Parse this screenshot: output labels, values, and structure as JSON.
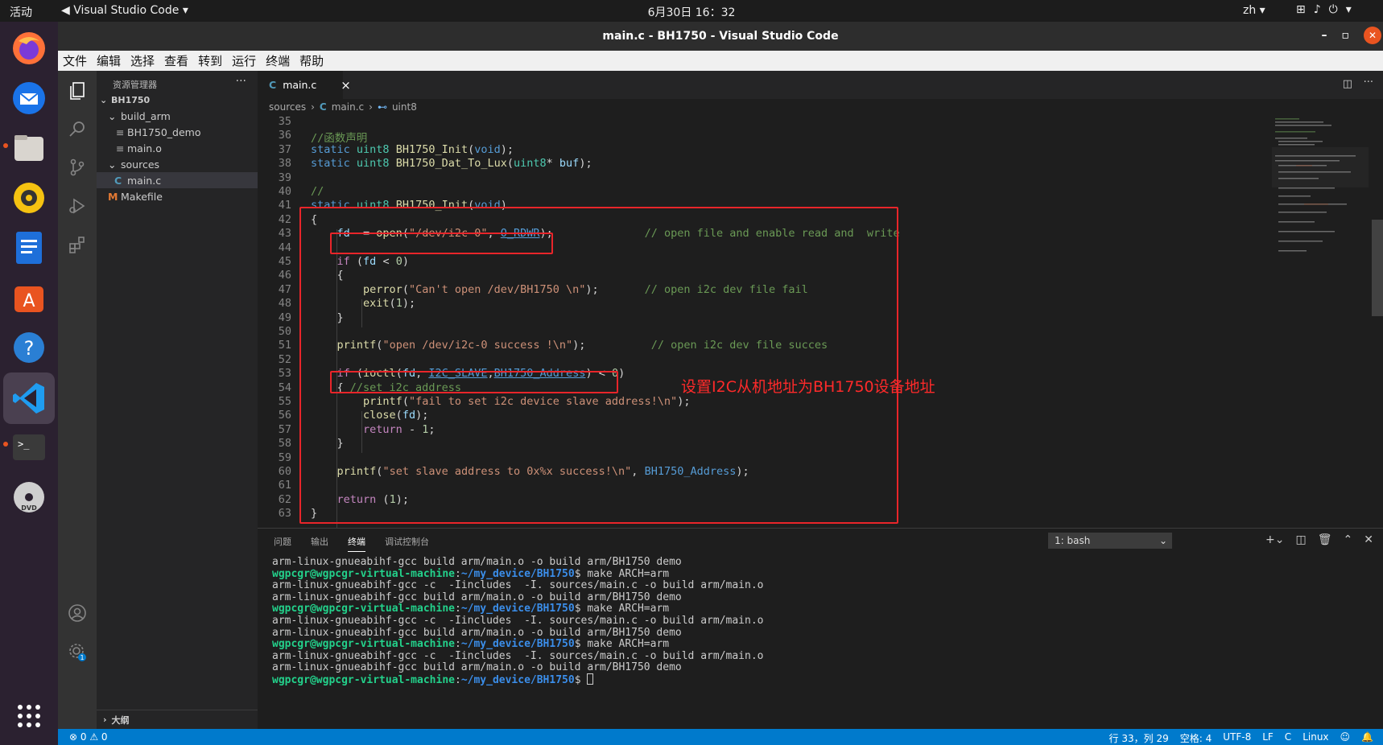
{
  "os": {
    "activities": "活动",
    "app_name": "Visual Studio Code",
    "clock": "6月30日  16：32",
    "input_lang": "zh"
  },
  "window": {
    "title": "main.c - BH1750 - Visual Studio Code"
  },
  "menu": [
    "文件",
    "编辑",
    "选择",
    "查看",
    "转到",
    "运行",
    "终端",
    "帮助"
  ],
  "explorer": {
    "header": "资源管理器",
    "more": "···",
    "project": "BH1750",
    "items": [
      {
        "label": "build_arm",
        "kind": "folder"
      },
      {
        "label": "BH1750_demo",
        "kind": "file"
      },
      {
        "label": "main.o",
        "kind": "file"
      },
      {
        "label": "sources",
        "kind": "folder"
      },
      {
        "label": "main.c",
        "kind": "c"
      },
      {
        "label": "Makefile",
        "kind": "make"
      }
    ],
    "outline": "大纲"
  },
  "tab": {
    "icon": "C",
    "label": "main.c",
    "close": "×"
  },
  "breadcrumb": {
    "folder": "sources",
    "file": "main.c",
    "symbol": "uint8"
  },
  "editor": {
    "line_numbers": [
      "35",
      "36",
      "37",
      "38",
      "39",
      "40",
      "41",
      "42",
      "43",
      "44",
      "45",
      "46",
      "47",
      "48",
      "49",
      "50",
      "51",
      "52",
      "53",
      "54",
      "55",
      "56",
      "57",
      "58",
      "59",
      "60",
      "61",
      "62",
      "63"
    ],
    "annotation": "设置I2C从机地址为BH1750设备地址",
    "colors": {
      "annotation": "#ff2a2a",
      "highlight_box": "#e8252a"
    }
  },
  "panel": {
    "tabs": [
      "问题",
      "输出",
      "终端",
      "调试控制台"
    ],
    "active_tab": "终端",
    "terminal_select": "1: bash",
    "lines": [
      {
        "type": "out",
        "text": "arm-linux-gnueabihf-gcc build arm/main.o -o build arm/BH1750 demo"
      },
      {
        "type": "prompt",
        "user": "wgpcgr@wgpcgr-virtual-machine",
        "path": "~/my_device/BH1750",
        "cmd": "$ make ARCH=arm"
      },
      {
        "type": "out",
        "text": "arm-linux-gnueabihf-gcc -c  -Iincludes  -I. sources/main.c -o build arm/main.o"
      },
      {
        "type": "out",
        "text": "arm-linux-gnueabihf-gcc build arm/main.o -o build arm/BH1750 demo"
      },
      {
        "type": "prompt",
        "user": "wgpcgr@wgpcgr-virtual-machine",
        "path": "~/my_device/BH1750",
        "cmd": "$ make ARCH=arm"
      },
      {
        "type": "out",
        "text": "arm-linux-gnueabihf-gcc -c  -Iincludes  -I. sources/main.c -o build arm/main.o"
      },
      {
        "type": "out",
        "text": "arm-linux-gnueabihf-gcc build arm/main.o -o build arm/BH1750 demo"
      },
      {
        "type": "prompt",
        "user": "wgpcgr@wgpcgr-virtual-machine",
        "path": "~/my_device/BH1750",
        "cmd": "$ make ARCH=arm"
      },
      {
        "type": "out",
        "text": "arm-linux-gnueabihf-gcc -c  -Iincludes  -I. sources/main.c -o build arm/main.o"
      },
      {
        "type": "out",
        "text": "arm-linux-gnueabihf-gcc build arm/main.o -o build arm/BH1750 demo"
      },
      {
        "type": "prompt",
        "user": "wgpcgr@wgpcgr-virtual-machine",
        "path": "~/my_device/BH1750",
        "cmd": "$ "
      }
    ]
  },
  "status": {
    "problems": "⊗ 0 ⚠ 0",
    "position": "行 33，列 29",
    "spaces": "空格: 4",
    "encoding": "UTF-8",
    "eol": "LF",
    "language": "C",
    "platform": "Linux",
    "settings_badge": "1"
  }
}
